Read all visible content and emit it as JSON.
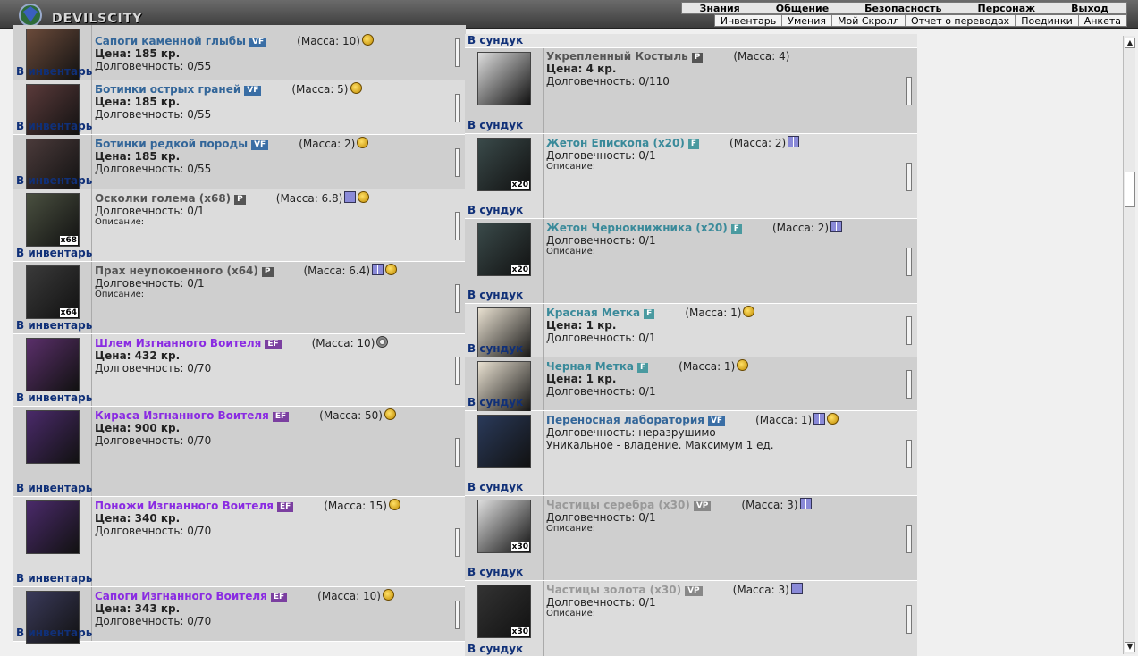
{
  "app": {
    "logo_text": "DEVILSCITY"
  },
  "menu": {
    "top": [
      "Знания",
      "Общение",
      "Безопасность",
      "Персонаж",
      "Выход"
    ],
    "sub": [
      "Инвентарь",
      "Умения",
      "Мой Скролл",
      "Отчет о переводах",
      "Поединки",
      "Анкета"
    ]
  },
  "labels": {
    "to_inventory": "В инвентарь",
    "to_chest": "В сундук",
    "price_prefix": "Цена:",
    "durability_prefix": "Долговечность:",
    "description": "Описание:"
  },
  "left_items": [
    {
      "name": "Сапоги каменной глыбы",
      "badge": "VF",
      "mass": "(Масса: 10)",
      "price": "Цена: 185 кр.",
      "dur": "Долговечность: 0/55",
      "action": "В инвентарь",
      "icons": [
        "coin"
      ],
      "color": "blue"
    },
    {
      "name": "Ботинки острых граней",
      "badge": "VF",
      "mass": "(Масса: 5)",
      "price": "Цена: 185 кр.",
      "dur": "Долговечность: 0/55",
      "action": "В инвентарь",
      "icons": [
        "coin"
      ],
      "color": "blue"
    },
    {
      "name": "Ботинки редкой породы",
      "badge": "VF",
      "mass": "(Масса: 2)",
      "price": "Цена: 185 кр.",
      "dur": "Долговечность: 0/55",
      "action": "В инвентарь",
      "icons": [
        "coin"
      ],
      "color": "blue"
    },
    {
      "name": "Осколки голема (x68)",
      "badge": "P",
      "mass": "(Масса: 6.8)",
      "price": "",
      "dur": "Долговечность: 0/1",
      "desc": "Описание:",
      "action": "В инвентарь",
      "icons": [
        "gift",
        "coin"
      ],
      "color": "grey",
      "count": "x68"
    },
    {
      "name": "Прах неупокоенного (x64)",
      "badge": "P",
      "mass": "(Масса: 6.4)",
      "price": "",
      "dur": "Долговечность: 0/1",
      "desc": "Описание:",
      "action": "В инвентарь",
      "icons": [
        "gift",
        "coin"
      ],
      "color": "grey",
      "count": "x64"
    },
    {
      "name": "Шлем Изгнанного Воителя",
      "badge": "EF",
      "mass": "(Масса: 10)",
      "price": "Цена: 432 кр.",
      "dur": "Долговечность: 0/70",
      "action": "В инвентарь",
      "icons": [
        "cog"
      ],
      "color": "purple"
    },
    {
      "name": "Кираса Изгнанного Воителя",
      "badge": "EF",
      "mass": "(Масса: 50)",
      "price": "Цена: 900 кр.",
      "dur": "Долговечность: 0/70",
      "action": "В инвентарь",
      "icons": [
        "coin"
      ],
      "color": "purple"
    },
    {
      "name": "Поножи Изгнанного Воителя",
      "badge": "EF",
      "mass": "(Масса: 15)",
      "price": "Цена: 340 кр.",
      "dur": "Долговечность: 0/70",
      "action": "В инвентарь",
      "icons": [
        "coin"
      ],
      "color": "purple"
    },
    {
      "name": "Сапоги Изгнанного Воителя",
      "badge": "EF",
      "mass": "(Масса: 10)",
      "price": "Цена: 343 кр.",
      "dur": "Долговечность: 0/70",
      "action": "В инвентарь",
      "icons": [
        "coin"
      ],
      "color": "purple"
    }
  ],
  "right_items": [
    {
      "name": "Укрепленный Костыль",
      "badge": "P",
      "mass": "(Масса: 4)",
      "price": "Цена: 4 кр.",
      "dur": "Долговечность: 0/110",
      "action": "В сундук",
      "icons": [],
      "color": "grey"
    },
    {
      "name": "Жетон Епископа (x20)",
      "badge": "F",
      "mass": "(Масса: 2)",
      "price": "",
      "dur": "Долговечность: 0/1",
      "desc": "Описание:",
      "action": "В сундук",
      "icons": [
        "gift"
      ],
      "color": "teal",
      "count": "x20"
    },
    {
      "name": "Жетон Чернокнижника (x20)",
      "badge": "F",
      "mass": "(Масса: 2)",
      "price": "",
      "dur": "Долговечность: 0/1",
      "desc": "Описание:",
      "action": "В сундук",
      "icons": [
        "gift"
      ],
      "color": "teal",
      "count": "x20"
    },
    {
      "name": "Красная Метка",
      "badge": "F",
      "mass": "(Масса: 1)",
      "price": "Цена: 1 кр.",
      "dur": "Долговечность: 0/1",
      "action": "В сундук",
      "icons": [
        "coin"
      ],
      "color": "teal"
    },
    {
      "name": "Черная Метка",
      "badge": "F",
      "mass": "(Масса: 1)",
      "price": "Цена: 1 кр.",
      "dur": "Долговечность: 0/1",
      "action": "В сундук",
      "icons": [
        "coin"
      ],
      "color": "teal"
    },
    {
      "name": "Переносная лаборатория",
      "badge": "VF",
      "mass": "(Масса: 1)",
      "price": "",
      "dur": "Долговечность: неразрушимо",
      "extra": "Уникальное - владение. Максимум 1 ед.",
      "action": "В сундук",
      "icons": [
        "gift",
        "coin"
      ],
      "color": "blue"
    },
    {
      "name": "Частицы серебра (x30)",
      "badge": "VP",
      "mass": "(Масса: 3)",
      "price": "",
      "dur": "Долговечность: 0/1",
      "desc": "Описание:",
      "action": "В сундук",
      "icons": [
        "gift"
      ],
      "color": "faded",
      "count": "x30"
    },
    {
      "name": "Частицы золота (x30)",
      "badge": "VP",
      "mass": "(Масса: 3)",
      "price": "",
      "dur": "Долговечность: 0/1",
      "desc": "Описание:",
      "action": "В сундук",
      "icons": [
        "gift"
      ],
      "color": "faded",
      "count": "x30"
    }
  ],
  "top_right_action": "В сундук"
}
